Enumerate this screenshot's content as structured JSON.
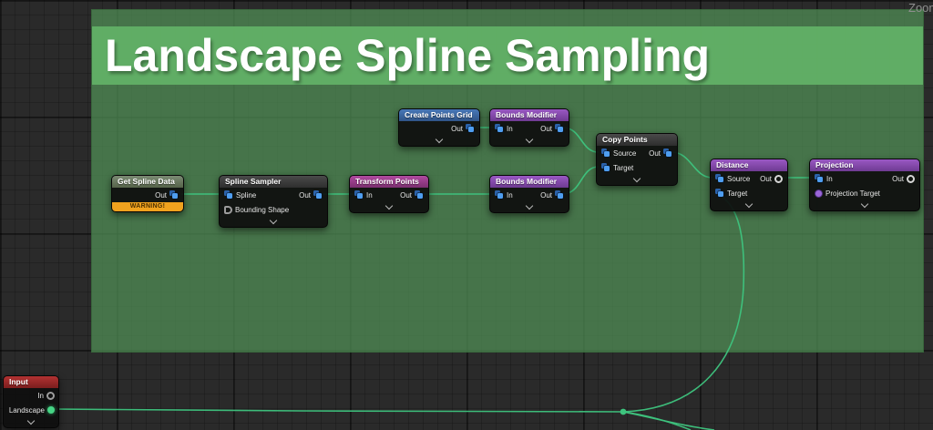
{
  "canvas": {
    "zoom_label": "Zoom"
  },
  "comment": {
    "title": "Landscape Spline Sampling"
  },
  "nodes": {
    "get_spline_data": {
      "title": "Get Spline Data",
      "out": "Out",
      "warning": "WARNING!"
    },
    "spline_sampler": {
      "title": "Spline Sampler",
      "in_spline": "Spline",
      "in_bounding_shape": "Bounding Shape",
      "out": "Out"
    },
    "transform_points": {
      "title": "Transform Points",
      "in": "In",
      "out": "Out"
    },
    "create_points_grid": {
      "title": "Create Points Grid",
      "out": "Out"
    },
    "bounds_modifier_top": {
      "title": "Bounds Modifier",
      "in": "In",
      "out": "Out"
    },
    "bounds_modifier_bottom": {
      "title": "Bounds Modifier",
      "in": "In",
      "out": "Out"
    },
    "copy_points": {
      "title": "Copy Points",
      "in_source": "Source",
      "in_target": "Target",
      "out": "Out"
    },
    "distance": {
      "title": "Distance",
      "in_source": "Source",
      "in_target": "Target",
      "out": "Out"
    },
    "projection": {
      "title": "Projection",
      "in": "In",
      "in_projection_target": "Projection Target",
      "out": "Out"
    },
    "input": {
      "title": "Input",
      "out_in": "In",
      "out_landscape": "Landscape"
    }
  },
  "colors": {
    "wire": "#3ec47e",
    "comment_body": "#4a7d4f",
    "comment_header": "#5fa863",
    "warning_bg": "#f0a21e",
    "header_sage": "#6e7d68",
    "header_dark": "#3a3a3a",
    "header_magenta": "#a8409a",
    "header_blue": "#3f6db0",
    "header_violet": "#8f4fb8",
    "header_red": "#a32b2b",
    "pin_data_blue": "#4f9ef0"
  }
}
